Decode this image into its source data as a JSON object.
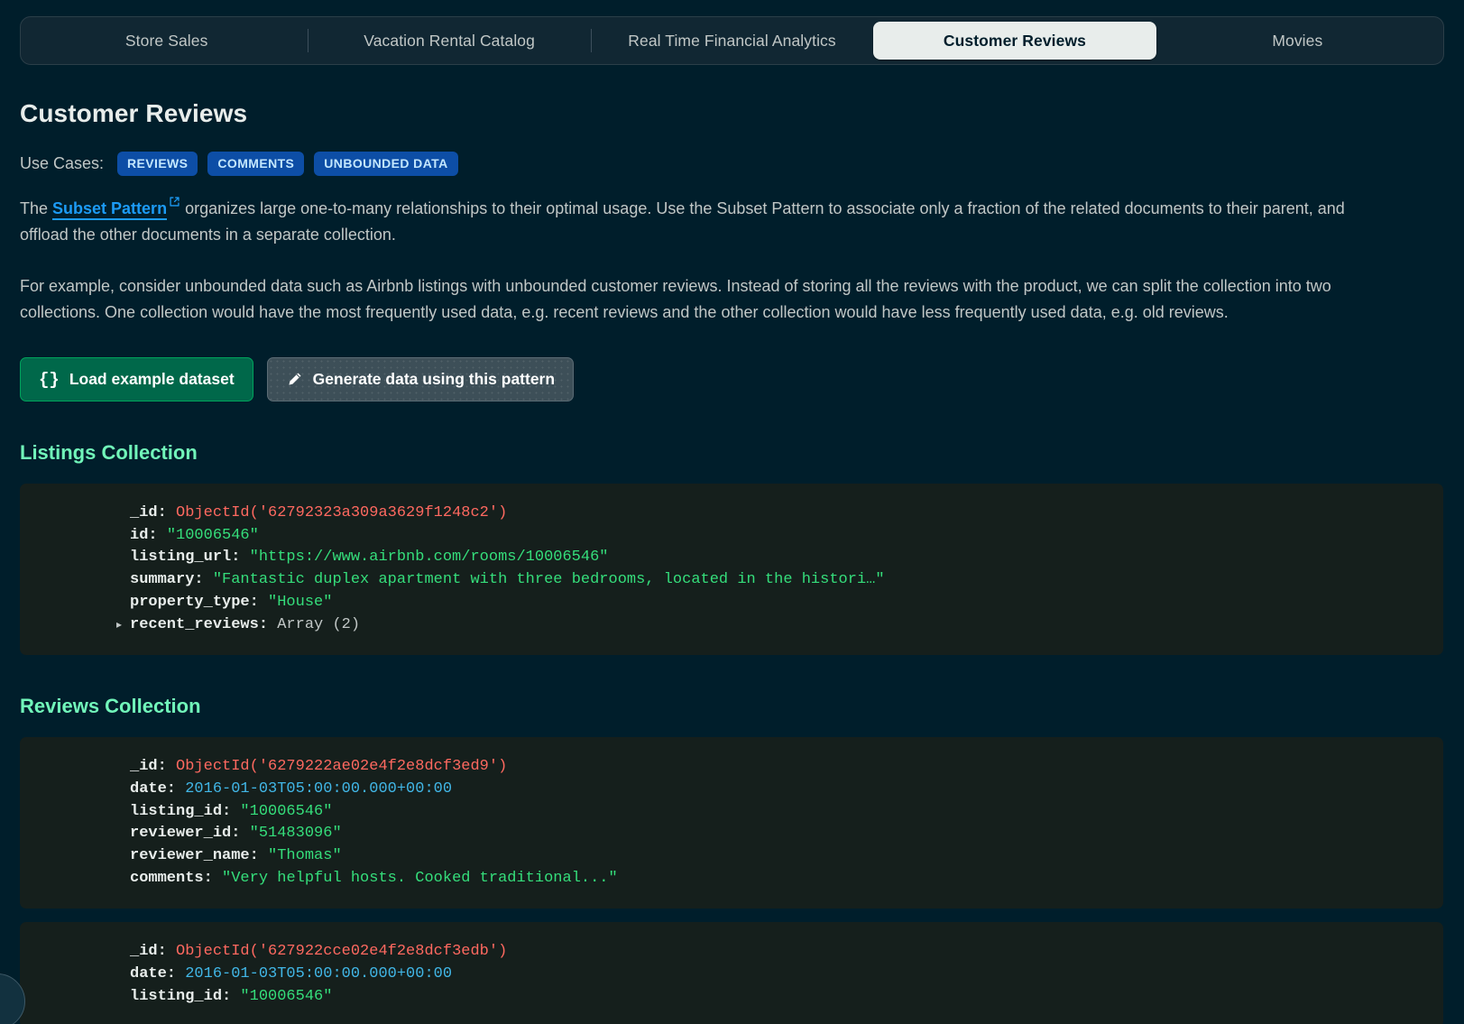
{
  "tabs": [
    {
      "label": "Store Sales",
      "active": false
    },
    {
      "label": "Vacation Rental Catalog",
      "active": false
    },
    {
      "label": "Real Time Financial Analytics",
      "active": false
    },
    {
      "label": "Customer Reviews",
      "active": true
    },
    {
      "label": "Movies",
      "active": false
    }
  ],
  "page": {
    "title": "Customer Reviews",
    "usecases_label": "Use Cases:",
    "badges": [
      "REVIEWS",
      "COMMENTS",
      "UNBOUNDED DATA"
    ],
    "paragraph1_prefix": "The ",
    "paragraph1_link": "Subset Pattern",
    "paragraph1_suffix": "  organizes large one-to-many relationships to their optimal usage. Use the Subset Pattern to associate only a fraction of the related documents to their parent, and offload the other documents in a separate collection.",
    "paragraph2": "For example, consider unbounded data such as Airbnb listings with unbounded customer reviews. Instead of storing all the reviews with the product, we can split the collection into two collections. One collection would have the most frequently used data, e.g. recent reviews and the other collection would have less frequently used data, e.g. old reviews."
  },
  "buttons": {
    "load_icon": "{}",
    "load_label": "Load example dataset",
    "generate_icon": "pencil-icon",
    "generate_label": "Generate data using this pattern"
  },
  "colors": {
    "page_bg": "#001e2b",
    "code_bg": "#151f1c",
    "accent_green": "#71f6ba",
    "link_blue": "#1c9bf5",
    "badge_bg": "#0d4ea6",
    "badge_text": "#c3e7fe",
    "button_green": "#00684a",
    "button_green_border": "#00a35c",
    "string_green": "#35de7b",
    "objectid_red": "#ff6960",
    "date_blue": "#41b6e6",
    "tab_active_bg": "#e8edeb"
  },
  "sections": [
    {
      "title": "Listings Collection",
      "cards": [
        {
          "lines": [
            {
              "key": "_id:",
              "value": "ObjectId('62792323a309a3629f1248c2')",
              "type": "oid",
              "triangle": false
            },
            {
              "key": "id:",
              "value": "\"10006546\"",
              "type": "str",
              "triangle": false
            },
            {
              "key": "listing_url:",
              "value": "\"https://www.airbnb.com/rooms/10006546\"",
              "type": "str",
              "triangle": false
            },
            {
              "key": "summary:",
              "value": "\"Fantastic duplex apartment with three bedrooms, located in the histori…\"",
              "type": "str",
              "triangle": false
            },
            {
              "key": "property_type:",
              "value": "\"House\"",
              "type": "str",
              "triangle": false
            },
            {
              "key": "recent_reviews:",
              "value": "Array (2)",
              "type": "meta",
              "triangle": true
            }
          ]
        }
      ]
    },
    {
      "title": "Reviews Collection",
      "cards": [
        {
          "lines": [
            {
              "key": "_id:",
              "value": "ObjectId('6279222ae02e4f2e8dcf3ed9')",
              "type": "oid",
              "triangle": false
            },
            {
              "key": "date:",
              "value": "2016-01-03T05:00:00.000+00:00",
              "type": "date",
              "triangle": false
            },
            {
              "key": "listing_id:",
              "value": "\"10006546\"",
              "type": "str",
              "triangle": false
            },
            {
              "key": "reviewer_id:",
              "value": "\"51483096\"",
              "type": "str",
              "triangle": false
            },
            {
              "key": "reviewer_name:",
              "value": "\"Thomas\"",
              "type": "str",
              "triangle": false
            },
            {
              "key": "comments:",
              "value": "\"Very helpful hosts. Cooked traditional...\"",
              "type": "str",
              "triangle": false
            }
          ]
        },
        {
          "lines": [
            {
              "key": "_id:",
              "value": "ObjectId('627922cce02e4f2e8dcf3edb')",
              "type": "oid",
              "triangle": false
            },
            {
              "key": "date:",
              "value": "2016-01-03T05:00:00.000+00:00",
              "type": "date",
              "triangle": false
            },
            {
              "key": "listing_id:",
              "value": "\"10006546\"",
              "type": "str",
              "triangle": false
            }
          ]
        }
      ]
    }
  ],
  "icons": {
    "external_link": "external-link-icon",
    "collapse_triangle": "▸"
  }
}
